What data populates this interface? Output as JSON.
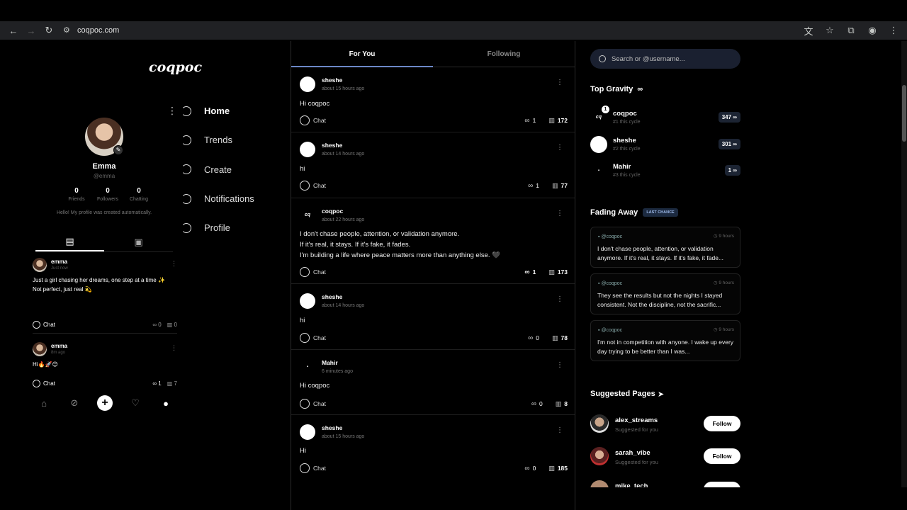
{
  "browser": {
    "url": "coqpoc.com"
  },
  "logo": "coqpoc",
  "profile": {
    "name": "Emma",
    "username": "@emma",
    "stats": [
      {
        "value": "0",
        "label": "Friends"
      },
      {
        "value": "0",
        "label": "Followers"
      },
      {
        "value": "0",
        "label": "Chatting"
      }
    ],
    "bio": "Hello! My profile was created automatically.",
    "posts": [
      {
        "name": "emma",
        "time": "Just now",
        "text_line1": "Just a girl chasing her dreams, one step at a time ✨",
        "text_line2": "Not perfect, just real 💫",
        "chat": "Chat",
        "gravity": "0",
        "views": "0"
      },
      {
        "name": "emma",
        "time": "8m ago",
        "text_line1": "Hi🔥🚀😊",
        "text_line2": "",
        "chat": "Chat",
        "gravity": "1",
        "views": "7"
      }
    ]
  },
  "menu": [
    {
      "label": "Home"
    },
    {
      "label": "Trends"
    },
    {
      "label": "Create"
    },
    {
      "label": "Notifications"
    },
    {
      "label": "Profile"
    }
  ],
  "feed": {
    "tabs": [
      "For You",
      "Following"
    ],
    "posts": [
      {
        "name": "sheshe",
        "time": "about 15 hours ago",
        "lines": [
          "Hi coqpoc"
        ],
        "chat": "Chat",
        "gravity": "1",
        "views": "172"
      },
      {
        "name": "sheshe",
        "time": "about 14 hours ago",
        "lines": [
          "hi"
        ],
        "chat": "Chat",
        "gravity": "1",
        "views": "77"
      },
      {
        "name": "coqpoc",
        "time": "about 22 hours ago",
        "lines": [
          "I don't chase people, attention, or validation anymore.",
          "If it's real, it stays. If it's fake, it fades.",
          "I'm building a life where peace matters more than anything else. 🖤"
        ],
        "chat": "Chat",
        "gravity": "1",
        "views": "173"
      },
      {
        "name": "sheshe",
        "time": "about 14 hours ago",
        "lines": [
          "hi"
        ],
        "chat": "Chat",
        "gravity": "0",
        "views": "78"
      },
      {
        "name": "Mahir",
        "time": "6 minutes ago",
        "lines": [
          "Hi coqpoc"
        ],
        "chat": "Chat",
        "gravity": "0",
        "views": "8"
      },
      {
        "name": "sheshe",
        "time": "about 15 hours ago",
        "lines": [
          "Hi"
        ],
        "chat": "Chat",
        "gravity": "0",
        "views": "185"
      }
    ]
  },
  "search": {
    "placeholder": "Search or @username..."
  },
  "top_gravity": {
    "title": "Top Gravity",
    "items": [
      {
        "name": "coqpoc",
        "sub": "#1 this cycle",
        "score": "347 ∞",
        "rank": "1"
      },
      {
        "name": "sheshe",
        "sub": "#2 this cycle",
        "score": "301 ∞"
      },
      {
        "name": "Mahir",
        "sub": "#3 this cycle",
        "score": "1 ∞"
      }
    ]
  },
  "fading": {
    "title": "Fading Away",
    "badge": "LAST CHANCE",
    "cards": [
      {
        "user": "@coqpoc",
        "time": "9 hours",
        "text": "I don't chase people, attention, or validation anymore. If it's real, it stays. If it's fake, it fade..."
      },
      {
        "user": "@coqpoc",
        "time": "9 hours",
        "text": "They see the results but not the nights I stayed consistent. Not the discipline, not the sacrific..."
      },
      {
        "user": "@coqpoc",
        "time": "9 hours",
        "text": "I'm not in competition with anyone. I wake up every day trying to be better than I was..."
      }
    ]
  },
  "suggested": {
    "title": "Suggested Pages",
    "items": [
      {
        "name": "alex_streams",
        "sub": "Suggested for you",
        "button": "Follow"
      },
      {
        "name": "sarah_vibe",
        "sub": "Suggested for you",
        "button": "Follow"
      },
      {
        "name": "mike_tech",
        "sub": "",
        "button": ""
      }
    ]
  },
  "colors": {
    "accent": "#6b87c7",
    "badge_bg": "#1c2a40",
    "score_bg": "#1c2433"
  }
}
